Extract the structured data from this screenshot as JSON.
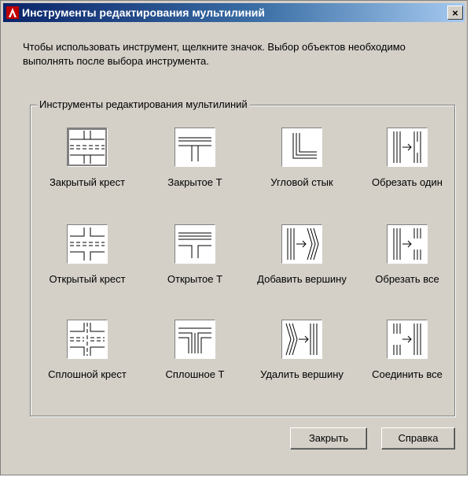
{
  "window": {
    "title": "Инструменты редактирования мультилиний",
    "close_symbol": "×"
  },
  "description": "Чтобы использовать инструмент, щелкните значок.  Выбор объектов необходимо выполнять после выбора инструмента.",
  "group": {
    "label": "Инструменты редактирования мультилиний"
  },
  "tools": [
    {
      "label": "Закрытый крест",
      "icon": "closed-cross-icon"
    },
    {
      "label": "Закрытое Т",
      "icon": "closed-tee-icon"
    },
    {
      "label": "Угловой стык",
      "icon": "corner-joint-icon"
    },
    {
      "label": "Обрезать один",
      "icon": "cut-single-icon"
    },
    {
      "label": "Открытый крест",
      "icon": "open-cross-icon"
    },
    {
      "label": "Открытое Т",
      "icon": "open-tee-icon"
    },
    {
      "label": "Добавить вершину",
      "icon": "add-vertex-icon"
    },
    {
      "label": "Обрезать все",
      "icon": "cut-all-icon"
    },
    {
      "label": "Сплошной крест",
      "icon": "merged-cross-icon"
    },
    {
      "label": "Сплошное Т",
      "icon": "merged-tee-icon"
    },
    {
      "label": "Удалить вершину",
      "icon": "delete-vertex-icon"
    },
    {
      "label": "Соединить все",
      "icon": "weld-all-icon"
    }
  ],
  "buttons": {
    "close_label": "Закрыть",
    "help_label": "Справка"
  },
  "colors": {
    "titlebar_start": "#0a246a",
    "titlebar_end": "#a6caf0",
    "dialog_face": "#d4d0c8"
  }
}
